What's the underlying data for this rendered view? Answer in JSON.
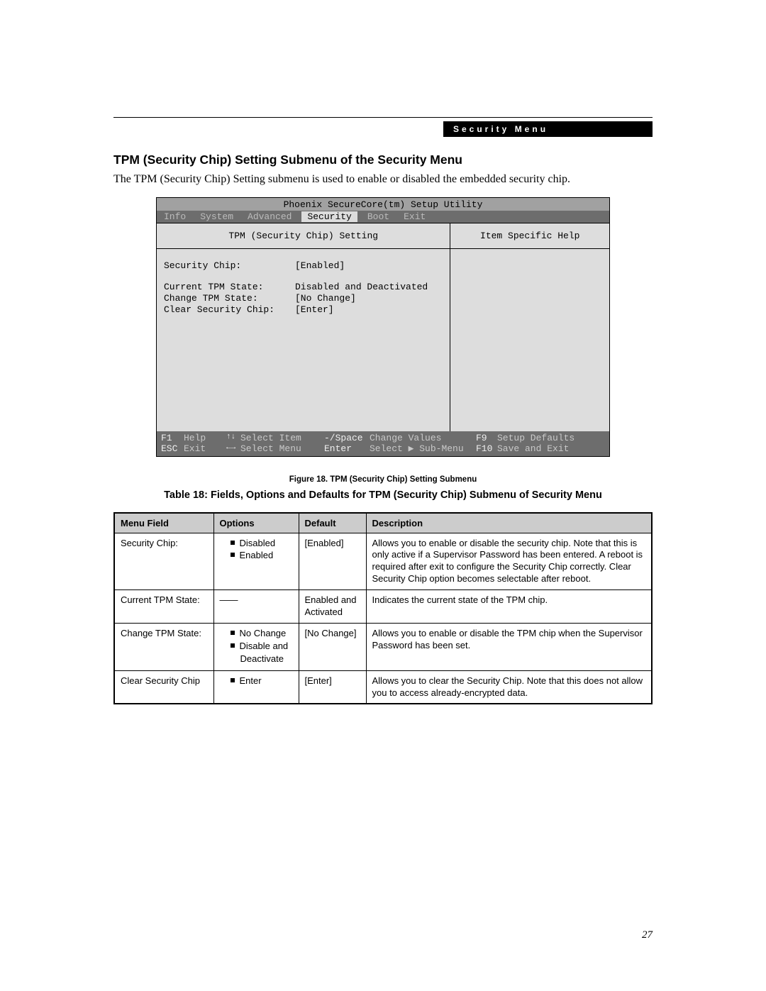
{
  "header_label": "Security Menu",
  "section_title": "TPM (Security Chip) Setting Submenu of the Security Menu",
  "section_description": "The TPM (Security Chip) Setting submenu is used to enable or disabled the embedded security chip.",
  "bios": {
    "title": "Phoenix SecureCore(tm) Setup Utility",
    "tabs": [
      "Info",
      "System",
      "Advanced",
      "Security",
      "Boot",
      "Exit"
    ],
    "active_tab": "Security",
    "left_header": "TPM (Security Chip) Setting",
    "right_header": "Item Specific Help",
    "fields": [
      {
        "label": "Security Chip:",
        "value": "[Enabled]"
      },
      {
        "spacer": true
      },
      {
        "label": "Current TPM State:",
        "value": "Disabled and Deactivated"
      },
      {
        "label": "Change TPM State:",
        "value": "[No Change]"
      },
      {
        "label": "Clear Security Chip:",
        "value": "[Enter]"
      }
    ],
    "footer": {
      "r1": {
        "k1": "F1",
        "t1": "Help",
        "a1": "↑↓",
        "t2": "Select Item",
        "k2": "-/Space",
        "t3": "Change Values",
        "k3": "F9",
        "t4": "Setup Defaults"
      },
      "r2": {
        "k1": "ESC",
        "t1": "Exit",
        "a1": "←→",
        "t2": "Select Menu",
        "k2": "Enter",
        "t3": "Select ▶ Sub-Menu",
        "k3": "F10",
        "t4": "Save and Exit"
      }
    }
  },
  "figure_caption": "Figure 18.  TPM (Security Chip) Setting Submenu",
  "table_caption": "Table 18: Fields, Options and Defaults for TPM (Security Chip) Submenu of Security Menu",
  "table": {
    "headers": [
      "Menu Field",
      "Options",
      "Default",
      "Description"
    ],
    "rows": [
      {
        "menu_field": "Security Chip:",
        "options": [
          "Disabled",
          "Enabled"
        ],
        "dash": false,
        "default": "[Enabled]",
        "description": "Allows you to enable or disable the security chip. Note that this is only active if a Supervisor Password has been entered. A reboot is required after exit to configure the Security Chip correctly. Clear Security Chip option becomes selectable after reboot."
      },
      {
        "menu_field": "Current TPM State:",
        "options": [],
        "dash": true,
        "default": "Enabled and Activated",
        "description": "Indicates the current state of the TPM chip."
      },
      {
        "menu_field": "Change TPM State:",
        "options": [
          "No Change",
          "Disable and Deactivate"
        ],
        "dash": false,
        "default": "[No Change]",
        "description": "Allows you to enable or disable the TPM chip when the Supervisor Password has been set."
      },
      {
        "menu_field": "Clear Security Chip",
        "options": [
          "Enter"
        ],
        "dash": false,
        "default": "[Enter]",
        "description": "Allows you to clear the Security Chip. Note that this does not allow you to access already-encrypted data."
      }
    ]
  },
  "page_number": "27"
}
